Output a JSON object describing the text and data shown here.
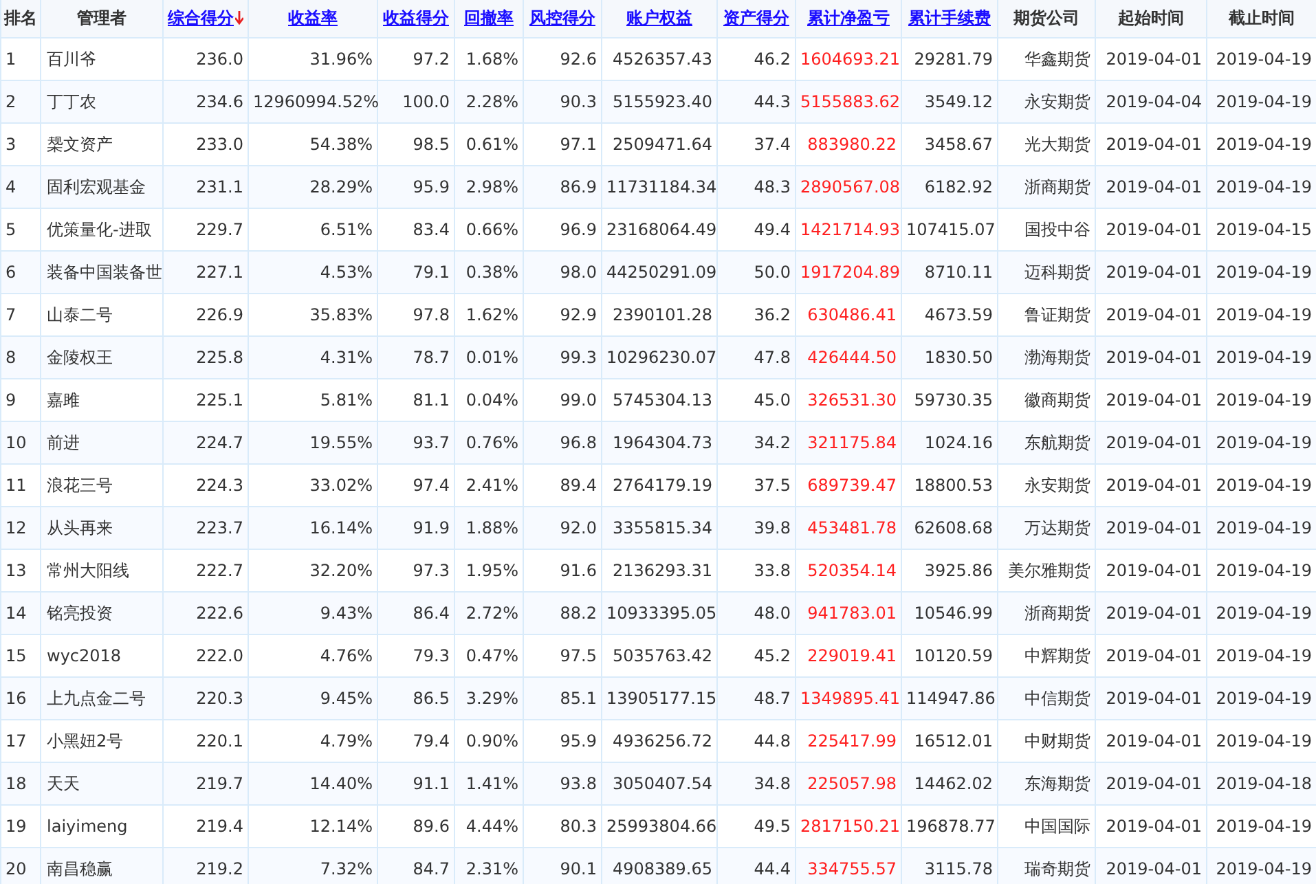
{
  "table": {
    "columns": [
      {
        "label": "排名",
        "kind": "rank",
        "link": false,
        "sorted": false
      },
      {
        "label": "管理者",
        "kind": "text",
        "link": false,
        "sorted": false
      },
      {
        "label": "综合得分",
        "kind": "number",
        "link": true,
        "sorted": true
      },
      {
        "label": "收益率",
        "kind": "number",
        "link": true,
        "sorted": false
      },
      {
        "label": "收益得分",
        "kind": "number",
        "link": true,
        "sorted": false
      },
      {
        "label": "回撤率",
        "kind": "number",
        "link": true,
        "sorted": false
      },
      {
        "label": "风控得分",
        "kind": "number",
        "link": true,
        "sorted": false
      },
      {
        "label": "账户权益",
        "kind": "number",
        "link": true,
        "sorted": false
      },
      {
        "label": "资产得分",
        "kind": "number",
        "link": true,
        "sorted": false
      },
      {
        "label": "累计净盈亏",
        "kind": "profit",
        "link": true,
        "sorted": false
      },
      {
        "label": "累计手续费",
        "kind": "number",
        "link": true,
        "sorted": false
      },
      {
        "label": "期货公司",
        "kind": "number",
        "link": false,
        "sorted": false
      },
      {
        "label": "起始时间",
        "kind": "number",
        "link": false,
        "sorted": false
      },
      {
        "label": "截止时间",
        "kind": "number",
        "link": false,
        "sorted": false
      }
    ],
    "rows": [
      [
        "1",
        "百川爷",
        "236.0",
        "31.96%",
        "97.2",
        "1.68%",
        "92.6",
        "4526357.43",
        "46.2",
        "1604693.21",
        "29281.79",
        "华鑫期货",
        "2019-04-01",
        "2019-04-19"
      ],
      [
        "2",
        "丁丁农",
        "234.6",
        "12960994.52%",
        "100.0",
        "2.28%",
        "90.3",
        "5155923.40",
        "44.3",
        "5155883.62",
        "3549.12",
        "永安期货",
        "2019-04-04",
        "2019-04-19"
      ],
      [
        "3",
        "椝文资产",
        "233.0",
        "54.38%",
        "98.5",
        "0.61%",
        "97.1",
        "2509471.64",
        "37.4",
        "883980.22",
        "3458.67",
        "光大期货",
        "2019-04-01",
        "2019-04-19"
      ],
      [
        "4",
        "固利宏观基金",
        "231.1",
        "28.29%",
        "95.9",
        "2.98%",
        "86.9",
        "11731184.34",
        "48.3",
        "2890567.08",
        "6182.92",
        "浙商期货",
        "2019-04-01",
        "2019-04-19"
      ],
      [
        "5",
        "优策量化-进取",
        "229.7",
        "6.51%",
        "83.4",
        "0.66%",
        "96.9",
        "23168064.49",
        "49.4",
        "1421714.93",
        "107415.07",
        "国投中谷",
        "2019-04-01",
        "2019-04-15"
      ],
      [
        "6",
        "装备中国装备世",
        "227.1",
        "4.53%",
        "79.1",
        "0.38%",
        "98.0",
        "44250291.09",
        "50.0",
        "1917204.89",
        "8710.11",
        "迈科期货",
        "2019-04-01",
        "2019-04-19"
      ],
      [
        "7",
        "山泰二号",
        "226.9",
        "35.83%",
        "97.8",
        "1.62%",
        "92.9",
        "2390101.28",
        "36.2",
        "630486.41",
        "4673.59",
        "鲁证期货",
        "2019-04-01",
        "2019-04-19"
      ],
      [
        "8",
        "金陵权王",
        "225.8",
        "4.31%",
        "78.7",
        "0.01%",
        "99.3",
        "10296230.07",
        "47.8",
        "426444.50",
        "1830.50",
        "渤海期货",
        "2019-04-01",
        "2019-04-19"
      ],
      [
        "9",
        "嘉雎",
        "225.1",
        "5.81%",
        "81.1",
        "0.04%",
        "99.0",
        "5745304.13",
        "45.0",
        "326531.30",
        "59730.35",
        "徽商期货",
        "2019-04-01",
        "2019-04-19"
      ],
      [
        "10",
        "前进",
        "224.7",
        "19.55%",
        "93.7",
        "0.76%",
        "96.8",
        "1964304.73",
        "34.2",
        "321175.84",
        "1024.16",
        "东航期货",
        "2019-04-01",
        "2019-04-19"
      ],
      [
        "11",
        "浪花三号",
        "224.3",
        "33.02%",
        "97.4",
        "2.41%",
        "89.4",
        "2764179.19",
        "37.5",
        "689739.47",
        "18800.53",
        "永安期货",
        "2019-04-01",
        "2019-04-19"
      ],
      [
        "12",
        "从头再来",
        "223.7",
        "16.14%",
        "91.9",
        "1.88%",
        "92.0",
        "3355815.34",
        "39.8",
        "453481.78",
        "62608.68",
        "万达期货",
        "2019-04-01",
        "2019-04-19"
      ],
      [
        "13",
        "常州大阳线",
        "222.7",
        "32.20%",
        "97.3",
        "1.95%",
        "91.6",
        "2136293.31",
        "33.8",
        "520354.14",
        "3925.86",
        "美尔雅期货",
        "2019-04-01",
        "2019-04-19"
      ],
      [
        "14",
        "铭亮投资",
        "222.6",
        "9.43%",
        "86.4",
        "2.72%",
        "88.2",
        "10933395.05",
        "48.0",
        "941783.01",
        "10546.99",
        "浙商期货",
        "2019-04-01",
        "2019-04-19"
      ],
      [
        "15",
        "wyc2018",
        "222.0",
        "4.76%",
        "79.3",
        "0.47%",
        "97.5",
        "5035763.42",
        "45.2",
        "229019.41",
        "10120.59",
        "中辉期货",
        "2019-04-01",
        "2019-04-19"
      ],
      [
        "16",
        "上九点金二号",
        "220.3",
        "9.45%",
        "86.5",
        "3.29%",
        "85.1",
        "13905177.15",
        "48.7",
        "1349895.41",
        "114947.86",
        "中信期货",
        "2019-04-01",
        "2019-04-19"
      ],
      [
        "17",
        "小黑妞2号",
        "220.1",
        "4.79%",
        "79.4",
        "0.90%",
        "95.9",
        "4936256.72",
        "44.8",
        "225417.99",
        "16512.01",
        "中财期货",
        "2019-04-01",
        "2019-04-19"
      ],
      [
        "18",
        "天天",
        "219.7",
        "14.40%",
        "91.1",
        "1.41%",
        "93.8",
        "3050407.54",
        "34.8",
        "225057.98",
        "14462.02",
        "东海期货",
        "2019-04-01",
        "2019-04-18"
      ],
      [
        "19",
        "laiyimeng",
        "219.4",
        "12.14%",
        "89.6",
        "4.44%",
        "80.3",
        "25993804.66",
        "49.5",
        "2817150.21",
        "196878.77",
        "中国国际",
        "2019-04-01",
        "2019-04-19"
      ],
      [
        "20",
        "南昌稳赢",
        "219.2",
        "7.32%",
        "84.7",
        "2.31%",
        "90.1",
        "4908389.65",
        "44.4",
        "334755.57",
        "3115.78",
        "瑞奇期货",
        "2019-04-01",
        "2019-04-19"
      ]
    ]
  }
}
